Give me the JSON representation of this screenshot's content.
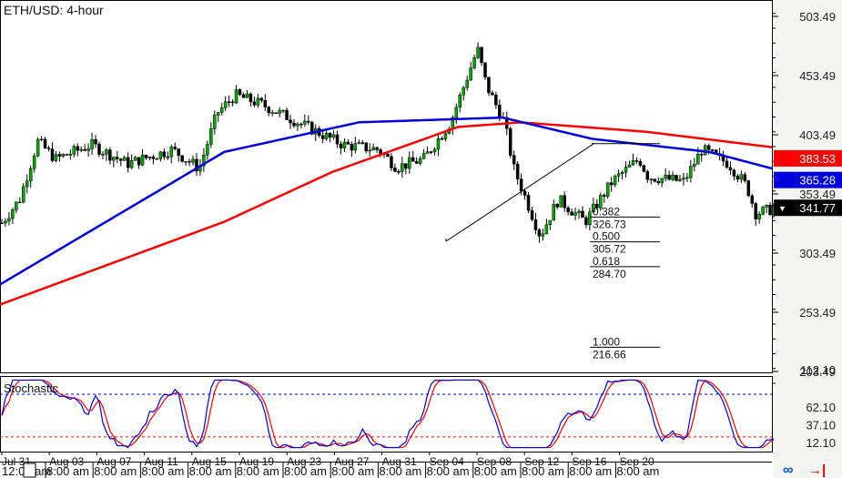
{
  "chart_data": {
    "type": "candlestick",
    "title": "ETH/USD: 4-hour",
    "y_ticks": [
      "503.49",
      "453.49",
      "403.49",
      "353.49",
      "303.49",
      "253.49",
      "203.49"
    ],
    "price_tags": [
      {
        "value": "383.53",
        "color": "#ff0000",
        "text_color": "#ffffff",
        "series": "red moving average"
      },
      {
        "value": "365.28",
        "color": "#0000dd",
        "text_color": "#ffffff",
        "series": "blue moving average"
      },
      {
        "value": "341.77",
        "color": "#000000",
        "text_color": "#ffffff",
        "series": "last price"
      }
    ],
    "x_ticks": [
      "Jul 31",
      "Aug 03",
      "Aug 07",
      "Aug 11",
      "Aug 15",
      "Aug 19",
      "Aug 23",
      "Aug 27",
      "Aug 31",
      "Sep 04",
      "Sep 08",
      "Sep 12",
      "Sep 16",
      "Sep 20"
    ],
    "time_row": [
      "12:00 am",
      "8:00 am",
      "8:00 am",
      "8:00 am",
      "8:00 am",
      "8:00 am",
      "8:00 am",
      "8:00 am",
      "8:00 am",
      "8:00 am",
      "8:00 am",
      "8:00 am",
      "8:00 am",
      "8:00 am"
    ],
    "ylim": [
      180,
      515
    ],
    "close_path": [
      [
        0,
        329
      ],
      [
        2,
        349
      ],
      [
        4,
        398
      ],
      [
        6,
        383
      ],
      [
        10,
        395
      ],
      [
        14,
        379
      ],
      [
        19,
        391
      ],
      [
        22,
        375
      ],
      [
        24,
        422
      ],
      [
        26,
        437
      ],
      [
        29,
        429
      ],
      [
        33,
        414
      ],
      [
        38,
        395
      ],
      [
        42,
        391
      ],
      [
        44,
        376
      ],
      [
        47,
        383
      ],
      [
        50,
        414
      ],
      [
        53,
        476
      ],
      [
        54,
        445
      ],
      [
        56,
        414
      ],
      [
        57,
        376
      ],
      [
        60,
        318
      ],
      [
        62,
        349
      ],
      [
        65,
        330
      ],
      [
        68,
        364
      ],
      [
        71,
        383
      ],
      [
        72,
        368
      ],
      [
        76,
        364
      ],
      [
        78,
        391
      ],
      [
        81,
        379
      ],
      [
        83,
        360
      ],
      [
        84,
        337
      ],
      [
        86,
        341
      ]
    ],
    "blue_ma": [
      [
        0,
        277
      ],
      [
        25,
        389
      ],
      [
        40,
        414
      ],
      [
        56,
        418
      ],
      [
        66,
        400
      ],
      [
        79,
        389
      ],
      [
        86,
        375
      ]
    ],
    "red_ma": [
      [
        0,
        260
      ],
      [
        25,
        330
      ],
      [
        37,
        372
      ],
      [
        51,
        410
      ],
      [
        58,
        414
      ],
      [
        72,
        406
      ],
      [
        86,
        393
      ]
    ],
    "fibonacci": [
      {
        "ratio": "0.382",
        "value": "326.73"
      },
      {
        "ratio": "0.500",
        "value": "305.72"
      },
      {
        "ratio": "0.618",
        "value": "284.70"
      },
      {
        "ratio": "1.000",
        "value": "216.66"
      }
    ],
    "fib_top": 396,
    "fib_values": [
      334,
      313,
      292,
      224
    ],
    "stochastic": {
      "title": "Stochastic",
      "ticks": [
        "112.10",
        "62.10",
        "37.10",
        "12.10"
      ],
      "overbought": 80,
      "oversold": 20
    }
  },
  "colors": {
    "blue": "#0000dd",
    "red": "#ff0000",
    "candle_up": "#00aa00",
    "candle_down": "#000000"
  }
}
